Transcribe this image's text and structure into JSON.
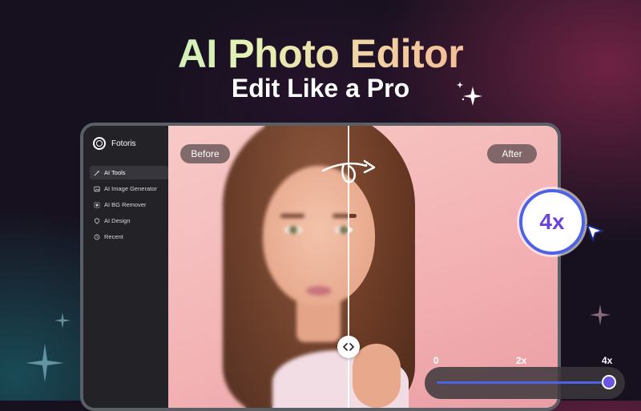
{
  "header": {
    "title": "AI Photo Editor",
    "subtitle": "Edit Like a Pro"
  },
  "app": {
    "name": "Fotoris"
  },
  "sidebar": {
    "items": [
      {
        "label": "AI Tools",
        "icon": "wand-icon",
        "active": true
      },
      {
        "label": "AI Image Generator",
        "icon": "image-icon",
        "active": false
      },
      {
        "label": "AI BG Remover",
        "icon": "remove-bg-icon",
        "active": false
      },
      {
        "label": "AI Design",
        "icon": "design-icon",
        "active": false
      },
      {
        "label": "Recent",
        "icon": "clock-icon",
        "active": false
      }
    ]
  },
  "compare": {
    "before_label": "Before",
    "after_label": "After"
  },
  "zoom": {
    "badge": "4x",
    "ticks": [
      "0",
      "2x",
      "4x"
    ],
    "level": 1.0
  },
  "colors": {
    "accent": "#4e62e6",
    "zoom_text": "#6a45d8"
  }
}
